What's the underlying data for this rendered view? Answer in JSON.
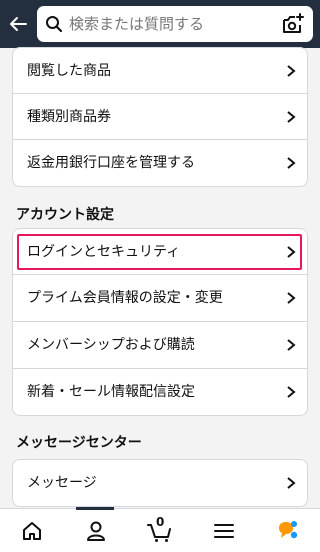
{
  "search": {
    "placeholder": "検索または質問する"
  },
  "lists": {
    "items_top": [
      {
        "label": "閲覧した商品"
      },
      {
        "label": "種類別商品券"
      },
      {
        "label": "返金用銀行口座を管理する"
      }
    ]
  },
  "account_settings": {
    "title": "アカウント設定",
    "items": [
      {
        "label": "ログインとセキュリティ"
      },
      {
        "label": "プライム会員情報の設定・変更"
      },
      {
        "label": "メンバーシップおよび購読"
      },
      {
        "label": "新着・セール情報配信設定"
      }
    ]
  },
  "message_center": {
    "title": "メッセージセンター",
    "items": [
      {
        "label": "メッセージ"
      }
    ]
  },
  "bottom_nav": {
    "cart_count": "0"
  },
  "colors": {
    "header": "#232f3e",
    "highlight": "#e8175d",
    "accent": "#ff9900"
  }
}
